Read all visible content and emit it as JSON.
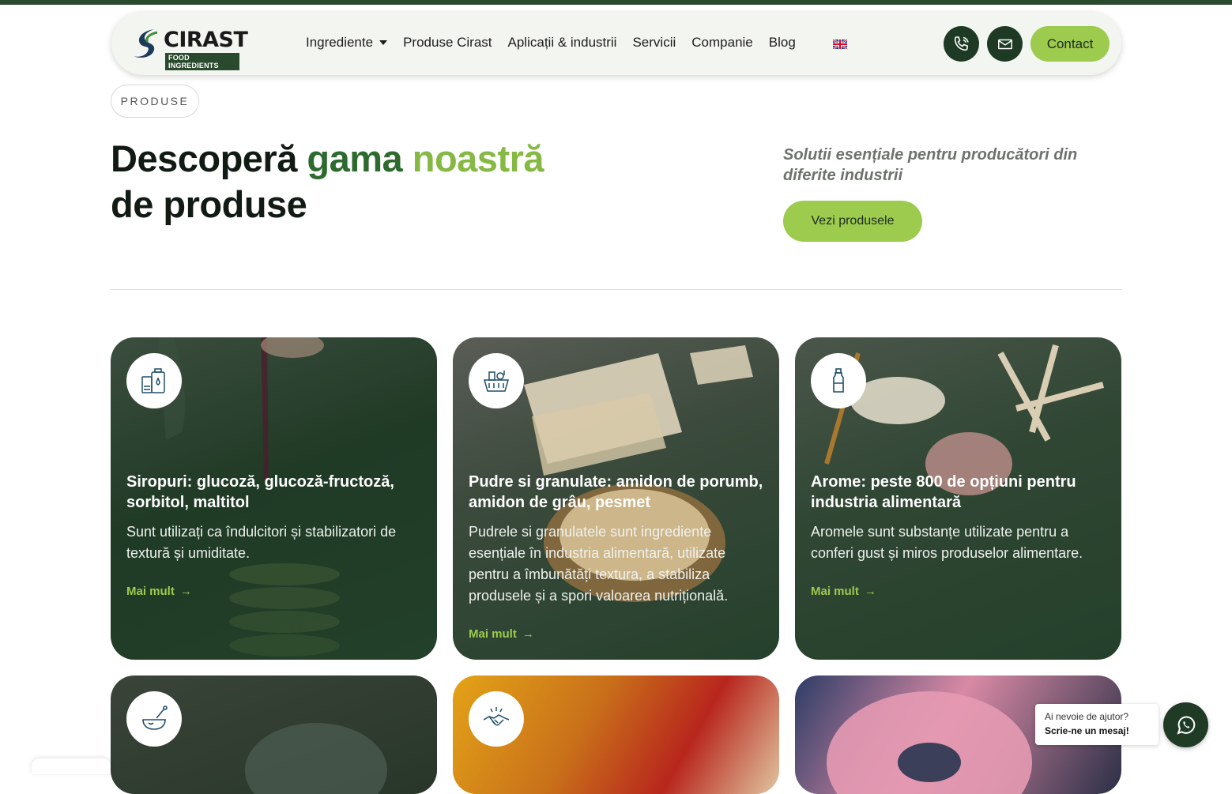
{
  "logo": {
    "name": "CIRAST",
    "subtitle": "FOOD INGREDIENTS"
  },
  "nav": {
    "items": [
      {
        "label": "Ingrediente",
        "has_dropdown": true
      },
      {
        "label": "Produse Cirast"
      },
      {
        "label": "Aplicații & industrii"
      },
      {
        "label": "Servicii"
      },
      {
        "label": "Companie"
      },
      {
        "label": "Blog"
      }
    ],
    "language_icon": "uk-flag-icon",
    "contact_label": "Contact"
  },
  "hero": {
    "pill": "PRODUSE",
    "headline_part1": "Descoperă ",
    "headline_green1": "gama ",
    "headline_green2": "noastră",
    "headline_part2": "de produse",
    "tagline": "Solutii esențiale pentru producători din diferite industrii",
    "cta_label": "Vezi produsele"
  },
  "cards": [
    {
      "icon": "syrup-bottles-icon",
      "title": "Siropuri: glucoză, glucoză-fructoză, sorbitol, maltitol",
      "description": "Sunt utilizați ca îndulcitori și stabilizatori de textură și umiditate.",
      "link": "Mai mult"
    },
    {
      "icon": "basket-icon",
      "title": "Pudre si granulate: amidon de porumb, amidon de grâu, pesmet",
      "description": "Pudrele si granulatele sunt ingrediente esențiale în industria alimentară, utilizate pentru a îmbunătăți textura, a stabiliza produsele și a spori valoarea nutrițională.",
      "link": "Mai mult"
    },
    {
      "icon": "flavor-bottle-icon",
      "title": "Arome: peste 800 de opțiuni pentru industria alimentară",
      "description": "Aromele sunt substanțe utilizate pentru a conferi gust și miros produselor alimentare.",
      "link": "Mai mult"
    },
    {
      "icon": "mortar-pestle-icon"
    },
    {
      "icon": "handshake-icon"
    },
    {
      "icon": ""
    }
  ],
  "chat": {
    "question": "Ai nevoie de ajutor?",
    "action": "Scrie-ne un mesaj!",
    "icon": "whatsapp-icon"
  },
  "colors": {
    "dark_green": "#1e3a24",
    "accent_green": "#9ccb4e",
    "headline_green": "#2d6a2e",
    "light_green": "#86b943"
  }
}
